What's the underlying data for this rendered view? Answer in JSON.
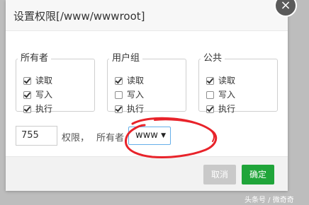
{
  "dialog": {
    "title": "设置权限[/www/wwwroot]",
    "close_symbol": "×"
  },
  "groups": [
    {
      "legend": "所有者",
      "items": [
        {
          "label": "读取",
          "checked": true
        },
        {
          "label": "写入",
          "checked": true
        },
        {
          "label": "执行",
          "checked": true
        }
      ]
    },
    {
      "legend": "用户组",
      "items": [
        {
          "label": "读取",
          "checked": true
        },
        {
          "label": "写入",
          "checked": false
        },
        {
          "label": "执行",
          "checked": true
        }
      ]
    },
    {
      "legend": "公共",
      "items": [
        {
          "label": "读取",
          "checked": true
        },
        {
          "label": "写入",
          "checked": false
        },
        {
          "label": "执行",
          "checked": true
        }
      ]
    }
  ],
  "permission": {
    "value": "755",
    "label": "权限，",
    "owner_label": "所有者",
    "owner_selected": "www",
    "dropdown_symbol": "▼"
  },
  "footer": {
    "cancel_label": "取消",
    "ok_label": "确定"
  },
  "watermark": "头条号 / 微奇奇",
  "colors": {
    "ok_button": "#20a53a",
    "cancel_button": "#c9c9c9",
    "annotation_stroke": "#e8232a",
    "select_focus_border": "#66afe9"
  }
}
